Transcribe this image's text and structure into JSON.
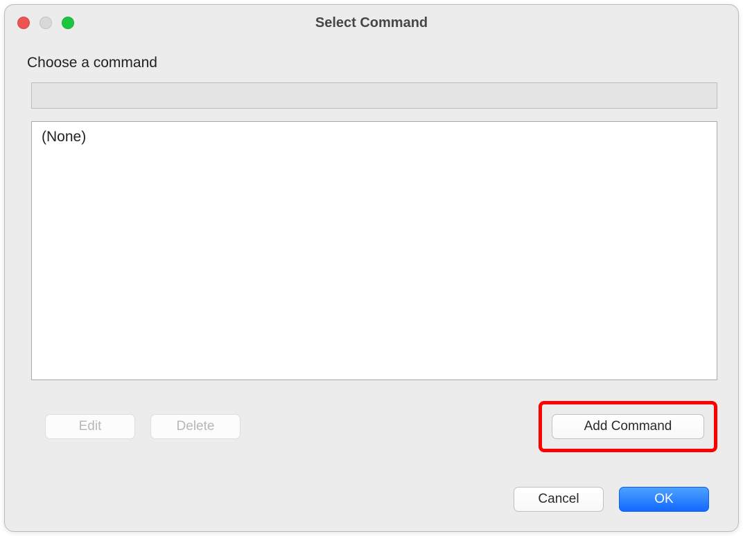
{
  "window": {
    "title": "Select Command"
  },
  "content": {
    "label": "Choose a command",
    "list_items": [
      "(None)"
    ]
  },
  "buttons": {
    "edit": "Edit",
    "delete": "Delete",
    "add": "Add Command",
    "cancel": "Cancel",
    "ok": "OK"
  }
}
